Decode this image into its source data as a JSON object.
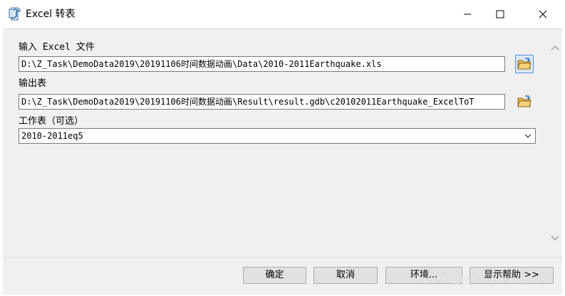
{
  "window": {
    "title": "Excel 转表",
    "icon": "python-script-icon",
    "controls": [
      "minimize-icon",
      "maximize-icon",
      "close-icon"
    ]
  },
  "form": {
    "input_excel": {
      "label": "输入 Excel 文件",
      "value": "D:\\Z_Task\\DemoData2019\\20191106时间数据动画\\Data\\2010-2011Earthquake.xls"
    },
    "output_table": {
      "label": "输出表",
      "value": "D:\\Z_Task\\DemoData2019\\20191106时间数据动画\\Result\\result.gdb\\c20102011Earthquake_ExcelToT"
    },
    "sheet": {
      "label": "工作表（可选）",
      "value": "2010-2011eq5"
    }
  },
  "buttons": {
    "ok": "确定",
    "cancel": "取消",
    "environments": "环境...",
    "show_help": "显示帮助 >>"
  },
  "watermark": "https://blog.csdn.net/weixin_beike"
}
